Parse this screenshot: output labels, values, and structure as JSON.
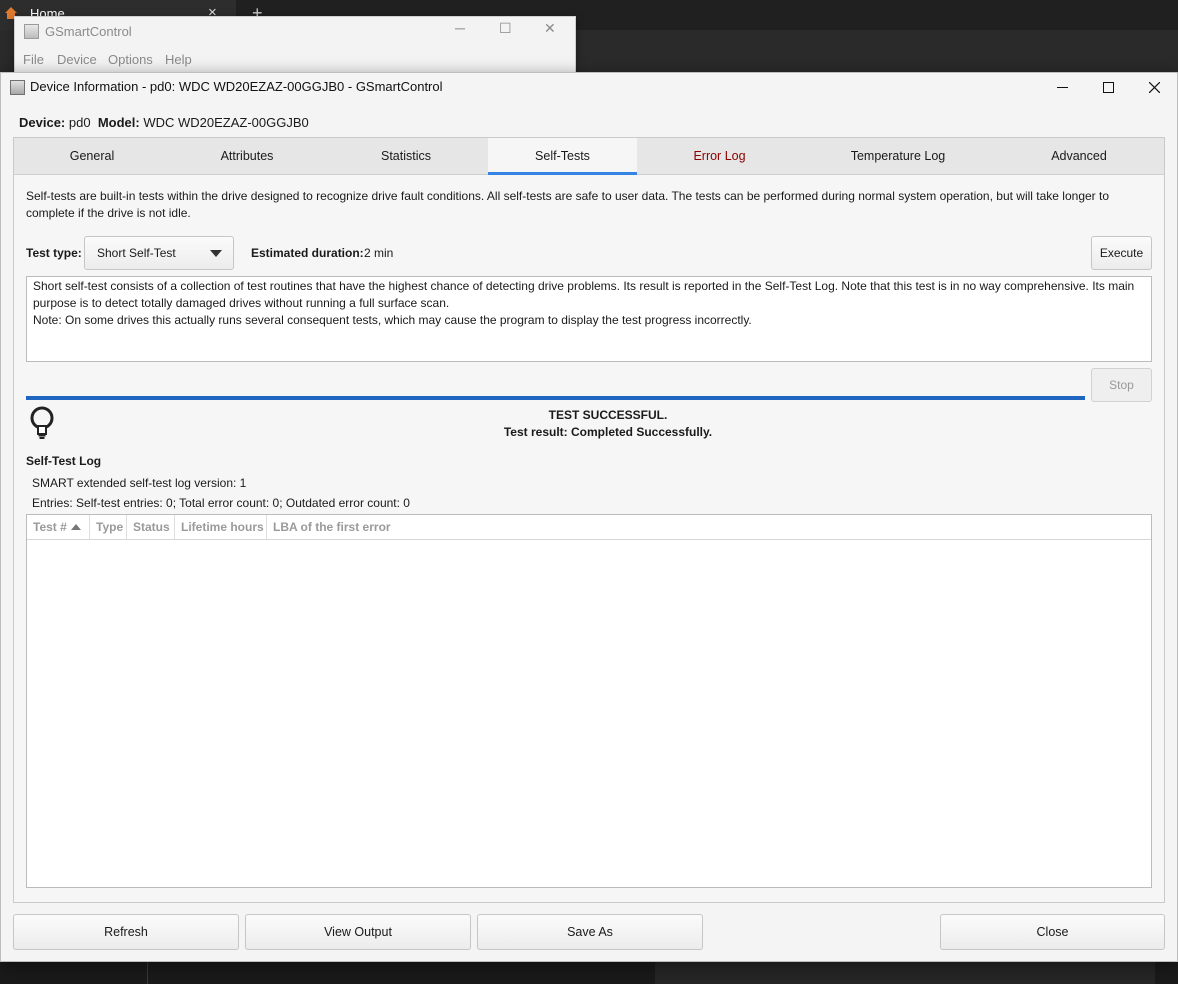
{
  "background": {
    "browser_tab_title": "Home",
    "new_tab_glyph": "+",
    "tab_close_glyph": "×"
  },
  "main_window": {
    "title": "GSmartControl",
    "menu": [
      "File",
      "Device",
      "Options",
      "Help"
    ]
  },
  "dialog": {
    "title": "Device Information - pd0: WDC WD20EZAZ-00GGJB0 - GSmartControl",
    "device_label": "Device:",
    "device_value": "pd0",
    "model_label": "Model:",
    "model_value": "WDC WD20EZAZ-00GGJB0"
  },
  "tabs": [
    {
      "label": "General"
    },
    {
      "label": "Attributes"
    },
    {
      "label": "Statistics"
    },
    {
      "label": "Self-Tests",
      "active": true
    },
    {
      "label": "Error Log",
      "warning": true
    },
    {
      "label": "Temperature Log"
    },
    {
      "label": "Advanced"
    }
  ],
  "selftests": {
    "intro": "Self-tests are built-in tests within the drive designed to recognize drive fault conditions. All self-tests are safe to user data. The tests can be performed during normal system operation, but will take longer to complete if the drive is not idle.",
    "test_type_label": "Test type:",
    "test_type_value": "Short Self-Test",
    "duration_label": "Estimated duration:",
    "duration_value": "2 min",
    "execute_label": "Execute",
    "stop_label": "Stop",
    "description_1": "Short self-test consists of a collection of test routines that have the highest chance of detecting drive problems. Its result is reported in the Self-Test Log. Note that this test is in no way comprehensive. Its main purpose is to detect totally damaged drives without running a full surface scan.",
    "description_2": "Note: On some drives this actually runs several consequent tests, which may cause the program to display the test progress incorrectly.",
    "progress_fraction": 1.0,
    "status_line_1": "TEST SUCCESSFUL.",
    "status_line_2": "Test result: Completed Successfully.",
    "log_title": "Self-Test Log",
    "log_version": "SMART extended self-test log version: 1",
    "log_entries": "Entries: Self-test entries: 0; Total error count: 0; Outdated error count: 0",
    "columns": [
      "Test #",
      "Type",
      "Status",
      "Lifetime hours",
      "LBA of the first error"
    ],
    "rows": []
  },
  "footer": {
    "refresh": "Refresh",
    "view_output": "View Output",
    "save_as": "Save As",
    "close": "Close"
  },
  "colors": {
    "accent": "#3584e4",
    "progress": "#1f66c1",
    "error_tab": "#8b0000"
  }
}
